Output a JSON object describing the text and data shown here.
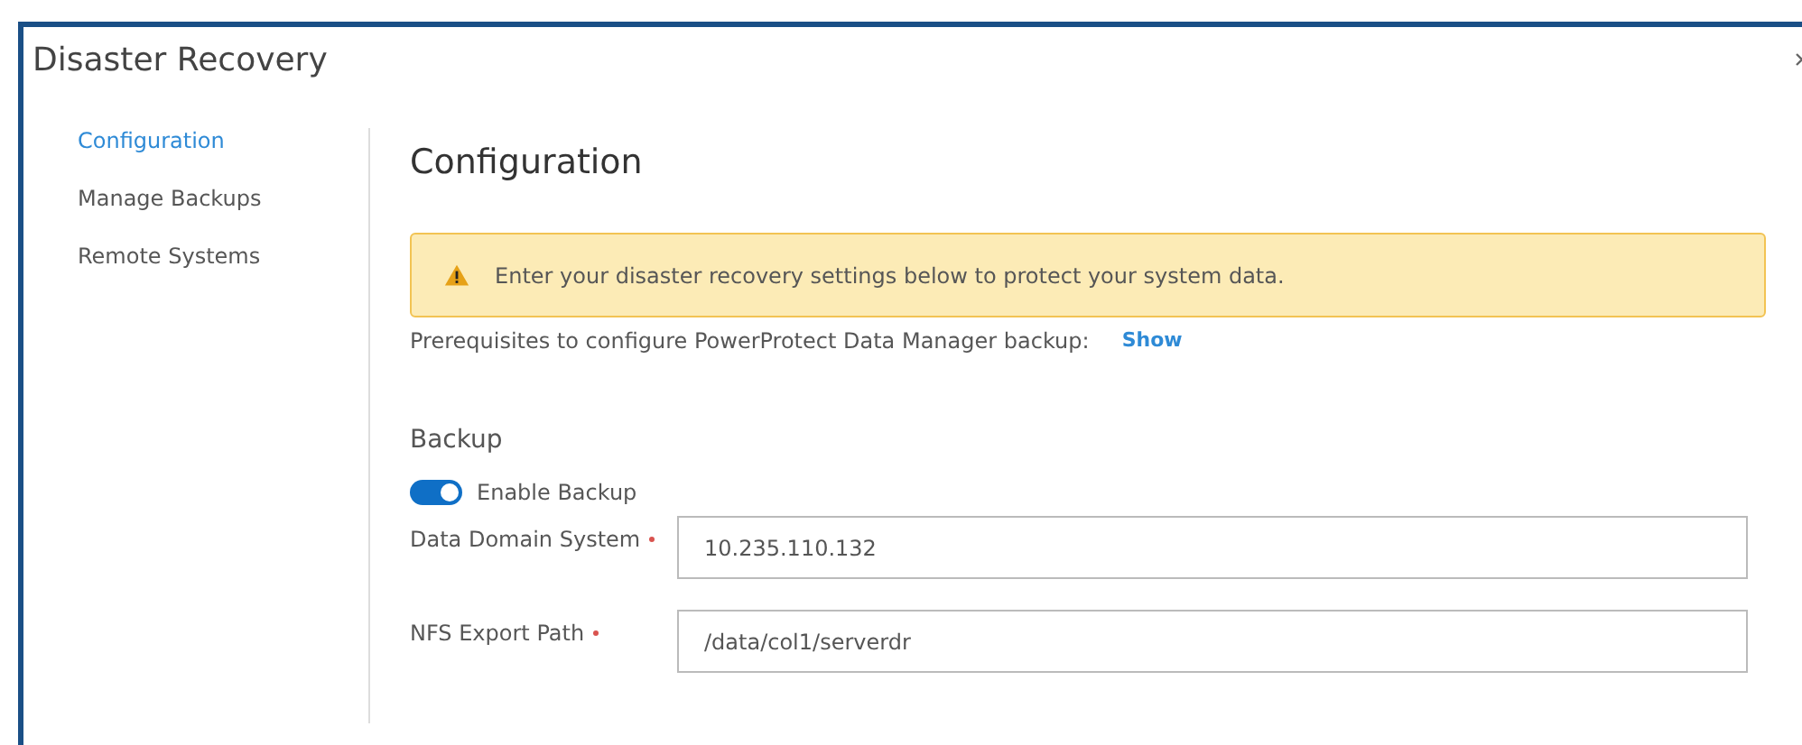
{
  "dialog": {
    "title": "Disaster Recovery"
  },
  "sidebar": {
    "items": [
      {
        "label": "Configuration",
        "selected": true
      },
      {
        "label": "Manage Backups",
        "selected": false
      },
      {
        "label": "Remote Systems",
        "selected": false
      }
    ]
  },
  "content": {
    "heading": "Configuration",
    "alert": {
      "kind": "warning",
      "message": "Enter your disaster recovery settings below to protect your system data."
    },
    "prerequisites": {
      "text": "Prerequisites to configure PowerProtect Data Manager backup:",
      "link": "Show"
    },
    "section": "Backup",
    "toggle": {
      "label": "Enable Backup",
      "on": true
    },
    "fields": [
      {
        "label": "Data Domain System",
        "required": true,
        "value": "10.235.110.132"
      },
      {
        "label": "NFS Export Path",
        "required": true,
        "value": "/data/col1/serverdr"
      }
    ]
  }
}
